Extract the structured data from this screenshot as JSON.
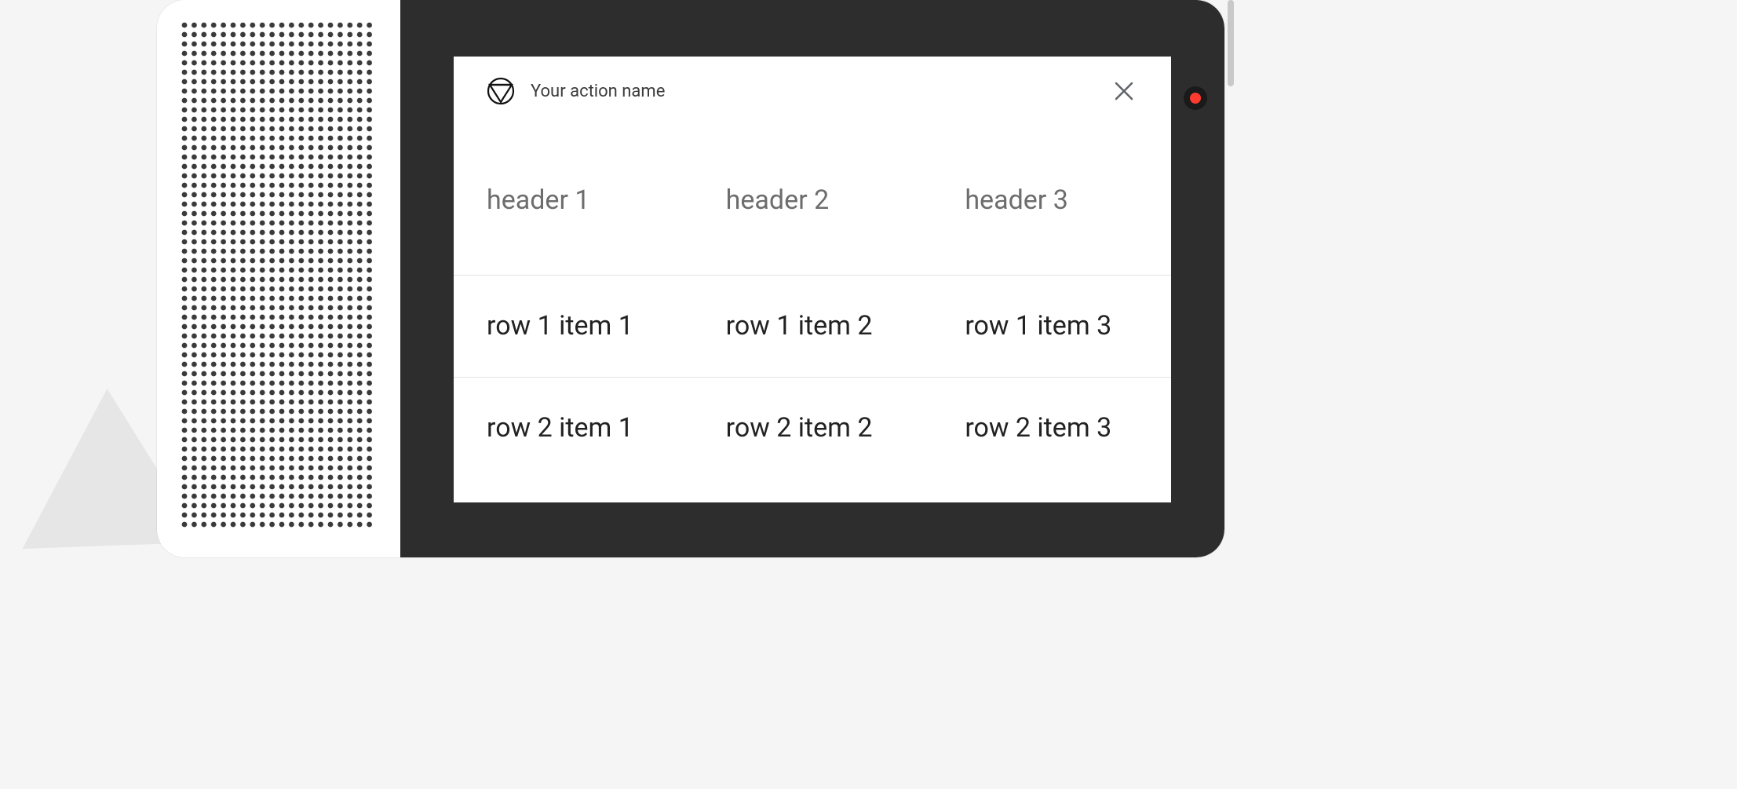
{
  "card": {
    "action_title": "Your action name",
    "table": {
      "headers": [
        "header 1",
        "header 2",
        "header 3"
      ],
      "rows": [
        [
          "row 1 item 1",
          "row 1 item 2",
          "row 1 item 3"
        ],
        [
          "row 2 item 1",
          "row 2 item 2",
          "row 2 item 3"
        ]
      ]
    }
  },
  "colors": {
    "screen_bg": "#2d2d2d",
    "card_bg": "#ffffff",
    "header_text": "#6d6d6d",
    "cell_text": "#222222",
    "divider": "#e4e4e4",
    "live_dot": "#ff3b30"
  }
}
